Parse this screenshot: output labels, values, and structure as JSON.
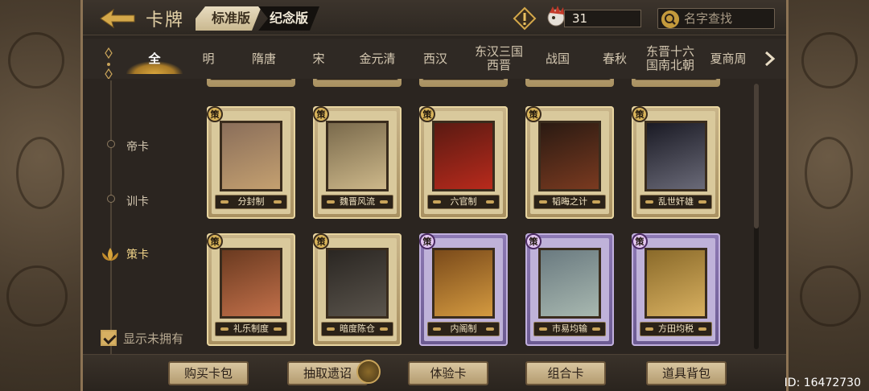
{
  "header": {
    "title": "卡牌",
    "version_active": "标准版",
    "version_inactive": "纪念版",
    "currency_value": "31",
    "search_placeholder": "名字查找"
  },
  "eras": [
    {
      "label": "全",
      "active": true
    },
    {
      "label": "明"
    },
    {
      "label": "隋唐"
    },
    {
      "label": "宋"
    },
    {
      "label": "金元清"
    },
    {
      "label": "西汉"
    },
    {
      "label": "东汉三国\n西晋"
    },
    {
      "label": "战国"
    },
    {
      "label": "春秋"
    },
    {
      "label": "东晋十六\n国南北朝"
    },
    {
      "label": "夏商周"
    }
  ],
  "categories": [
    {
      "label": "帝卡"
    },
    {
      "label": "训卡"
    },
    {
      "label": "策卡",
      "active": true
    }
  ],
  "show_unowned_label": "显示未拥有",
  "show_unowned_checked": true,
  "card_badge": "策",
  "cards_row1": [
    {
      "name": "分封制",
      "frame": "gold",
      "art": [
        "#8a6e5a",
        "#c4a070"
      ]
    },
    {
      "name": "魏晋风流",
      "frame": "gold",
      "art": [
        "#7a6a4c",
        "#cdb88a"
      ]
    },
    {
      "name": "六官制",
      "frame": "gold",
      "art": [
        "#5a1a12",
        "#b82a1c"
      ]
    },
    {
      "name": "韬晦之计",
      "frame": "gold",
      "art": [
        "#2a1a12",
        "#7a3a20"
      ]
    },
    {
      "name": "乱世奸雄",
      "frame": "gold",
      "art": [
        "#1a1a24",
        "#6a6a78"
      ]
    }
  ],
  "cards_row2": [
    {
      "name": "礼乐制度",
      "frame": "gold",
      "art": [
        "#6a3a20",
        "#c2704a"
      ]
    },
    {
      "name": "暗度陈仓",
      "frame": "gold",
      "art": [
        "#2a2622",
        "#5a544c"
      ]
    },
    {
      "name": "内阁制",
      "frame": "purple",
      "art": [
        "#7a4a1a",
        "#d49a40"
      ]
    },
    {
      "name": "市易均输",
      "frame": "purple",
      "art": [
        "#6a7a80",
        "#a8b8b0"
      ]
    },
    {
      "name": "方田均税",
      "frame": "purple",
      "art": [
        "#8a6a2a",
        "#d8b060"
      ]
    }
  ],
  "bottom_buttons": [
    "购买卡包",
    "抽取遗诏",
    "体验卡",
    "组合卡",
    "道具背包"
  ],
  "id_text": "ID: 16472730",
  "colors": {
    "gold_accent": "#c9a45a",
    "active_tab": "#ffffff",
    "background": "#2b2520"
  }
}
